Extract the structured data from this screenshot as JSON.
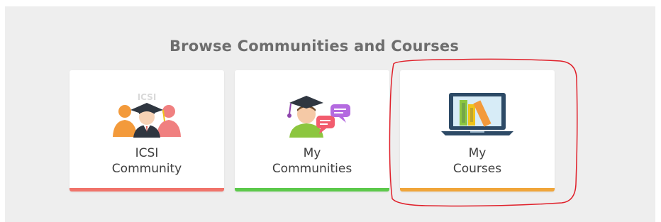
{
  "section": {
    "title": "Browse Communities and Courses"
  },
  "cards": [
    {
      "label": "ICSI\nCommunity",
      "icon": "community-graduate-icon",
      "accent": "#f0736a"
    },
    {
      "label": "My\nCommunities",
      "icon": "student-chat-icon",
      "accent": "#5cc94b"
    },
    {
      "label": "My\nCourses",
      "icon": "laptop-books-icon",
      "accent": "#f0a53a"
    }
  ],
  "annotation": {
    "color": "#e0202a"
  }
}
